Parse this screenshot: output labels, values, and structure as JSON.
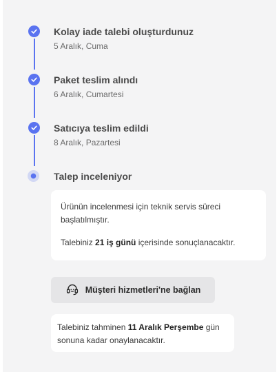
{
  "timeline": {
    "steps": [
      {
        "title": "Kolay iade talebi oluşturdunuz",
        "date": "5 Aralık, Cuma",
        "status": "done",
        "icon": "check-icon"
      },
      {
        "title": "Paket teslim alındı",
        "date": "6 Aralık, Cumartesi",
        "status": "done",
        "icon": "check-icon"
      },
      {
        "title": "Satıcıya teslim edildi",
        "date": "8 Aralık, Pazartesi",
        "status": "done",
        "icon": "check-icon"
      },
      {
        "title": "Talep inceleniyor",
        "status": "current",
        "icon": "pending-dot-icon"
      }
    ],
    "accent_color": "#5a73f0"
  },
  "info_card": {
    "line1": "Ürünün incelenmesi için teknik servis süreci başlatılmıştır.",
    "line2_prefix": "Talebiniz ",
    "line2_bold": "21 iş günü",
    "line2_suffix": " içerisinde sonuçlanacaktır."
  },
  "support_button": {
    "label": "Müşteri hizmetleri'ne bağlan",
    "icon": "headset-icon"
  },
  "estimate_card": {
    "prefix": "Talebiniz tahminen ",
    "bold": "11 Aralık Perşembe",
    "suffix": " gün sonuna kadar onaylanacaktır."
  }
}
